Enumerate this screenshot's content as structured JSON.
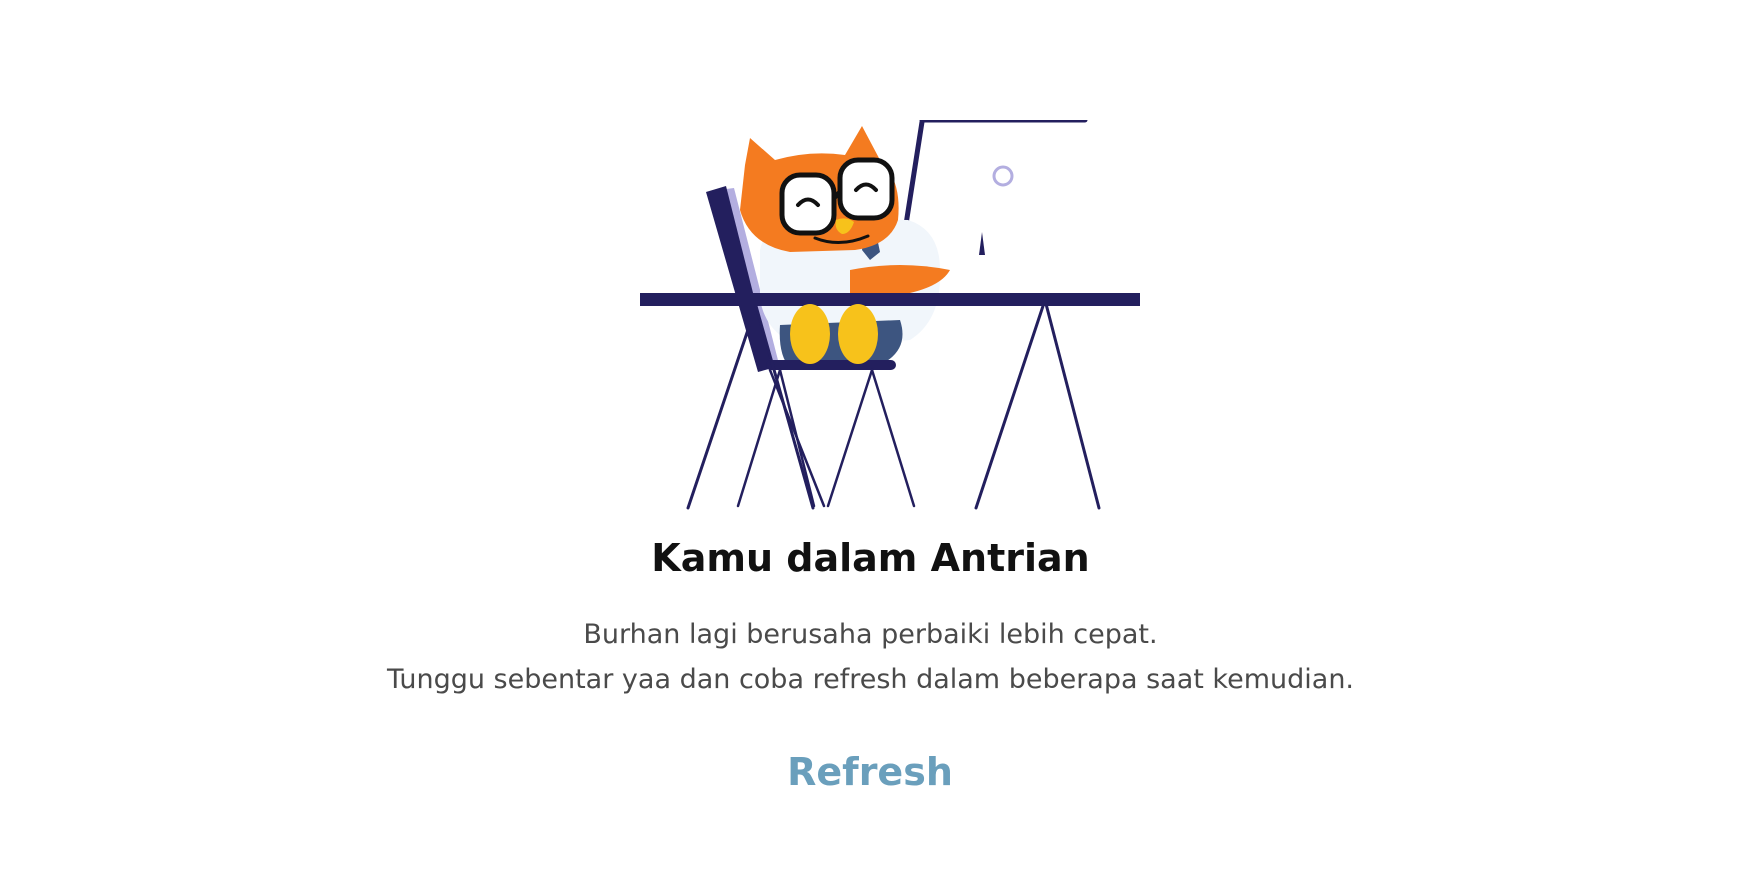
{
  "illustration": {
    "icon": "owl-mascot-at-desk-illustration",
    "colors": {
      "navy": "#231f5e",
      "orange": "#f47b20",
      "lavender": "#b3aee0",
      "yellow": "#f7c21b",
      "shirt": "#f1f6fb",
      "pants": "#3d5580"
    }
  },
  "main": {
    "title": "Kamu dalam Antrian",
    "description_line1": "Burhan lagi berusaha perbaiki lebih cepat.",
    "description_line2": "Tunggu sebentar yaa dan coba refresh dalam beberapa saat kemudian.",
    "refresh_label": "Refresh",
    "refresh_color": "#6a9fbc"
  }
}
